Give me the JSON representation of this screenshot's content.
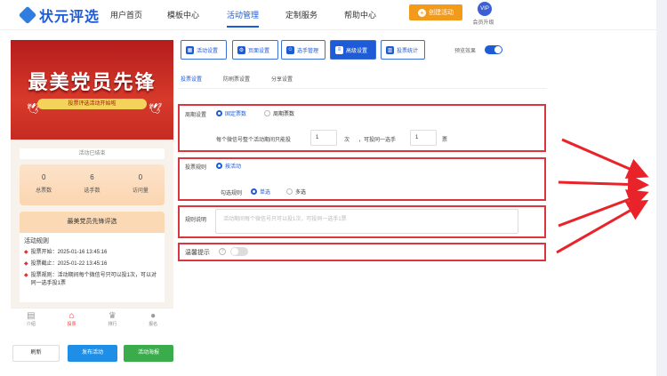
{
  "app": {
    "logo": "状元评选"
  },
  "nav": {
    "items": [
      "用户首页",
      "模板中心",
      "活动管理",
      "定制服务",
      "帮助中心"
    ],
    "create_label": "创建活动",
    "vip_badge": "VIP",
    "vip_label": "会员升级"
  },
  "preview": {
    "title": "最美党员先锋",
    "subtitle": "投票评选活动开始啦",
    "status": "活动已结束",
    "stats": [
      {
        "value": "0",
        "label": "总票数"
      },
      {
        "value": "6",
        "label": "选手数"
      },
      {
        "value": "0",
        "label": "访问量"
      }
    ],
    "card_title": "最美党员先锋评选",
    "rules_heading": "活动规则",
    "rules": [
      "投票开始：2025-01-16 13:45:16",
      "投票截止：2025-01-22 13:45:16",
      "投票规则：活动期间每个微信号只可以投1次，可以对同一选手投1票"
    ],
    "tabs": [
      {
        "label": "介绍",
        "icon": "document-icon"
      },
      {
        "label": "投票",
        "icon": "home-icon"
      },
      {
        "label": "排行",
        "icon": "crown-icon"
      },
      {
        "label": "报名",
        "icon": "person-icon"
      }
    ]
  },
  "actions": {
    "refresh": "刷新",
    "publish": "发布活动",
    "poster": "活动海报"
  },
  "toolbar": {
    "items": [
      "活动设置",
      "页面设置",
      "选手管理",
      "高级设置",
      "投票统计"
    ],
    "active": "高级设置",
    "preview_label": "预览效果"
  },
  "subtabs": [
    "投票设置",
    "防刷票设置",
    "分享设置"
  ],
  "settings": {
    "period": {
      "label": "周期设置",
      "options": [
        "固定票数",
        "周期票数"
      ],
      "selected": "固定票数",
      "text1": "每个微信号整个活动期间只能投",
      "value1": "1",
      "text2": "次",
      "text3": "，可投同一选手",
      "value2": "1",
      "text4": "票"
    },
    "vote_rule": {
      "label": "投票规则",
      "option": "按活动",
      "check_label": "勾选规则",
      "check_options": [
        "单选",
        "多选"
      ],
      "check_selected": "单选"
    },
    "rule_desc": {
      "label": "规则说明",
      "placeholder": "活动期间每个微信号只可以投1次，可投同一选手1票"
    },
    "tip": {
      "label": "温馨提示",
      "help": "?"
    }
  },
  "colors": {
    "brand": "#1e5bd6",
    "highlight": "#d9363e",
    "orange": "#f39a1b",
    "green": "#3aac4b"
  }
}
